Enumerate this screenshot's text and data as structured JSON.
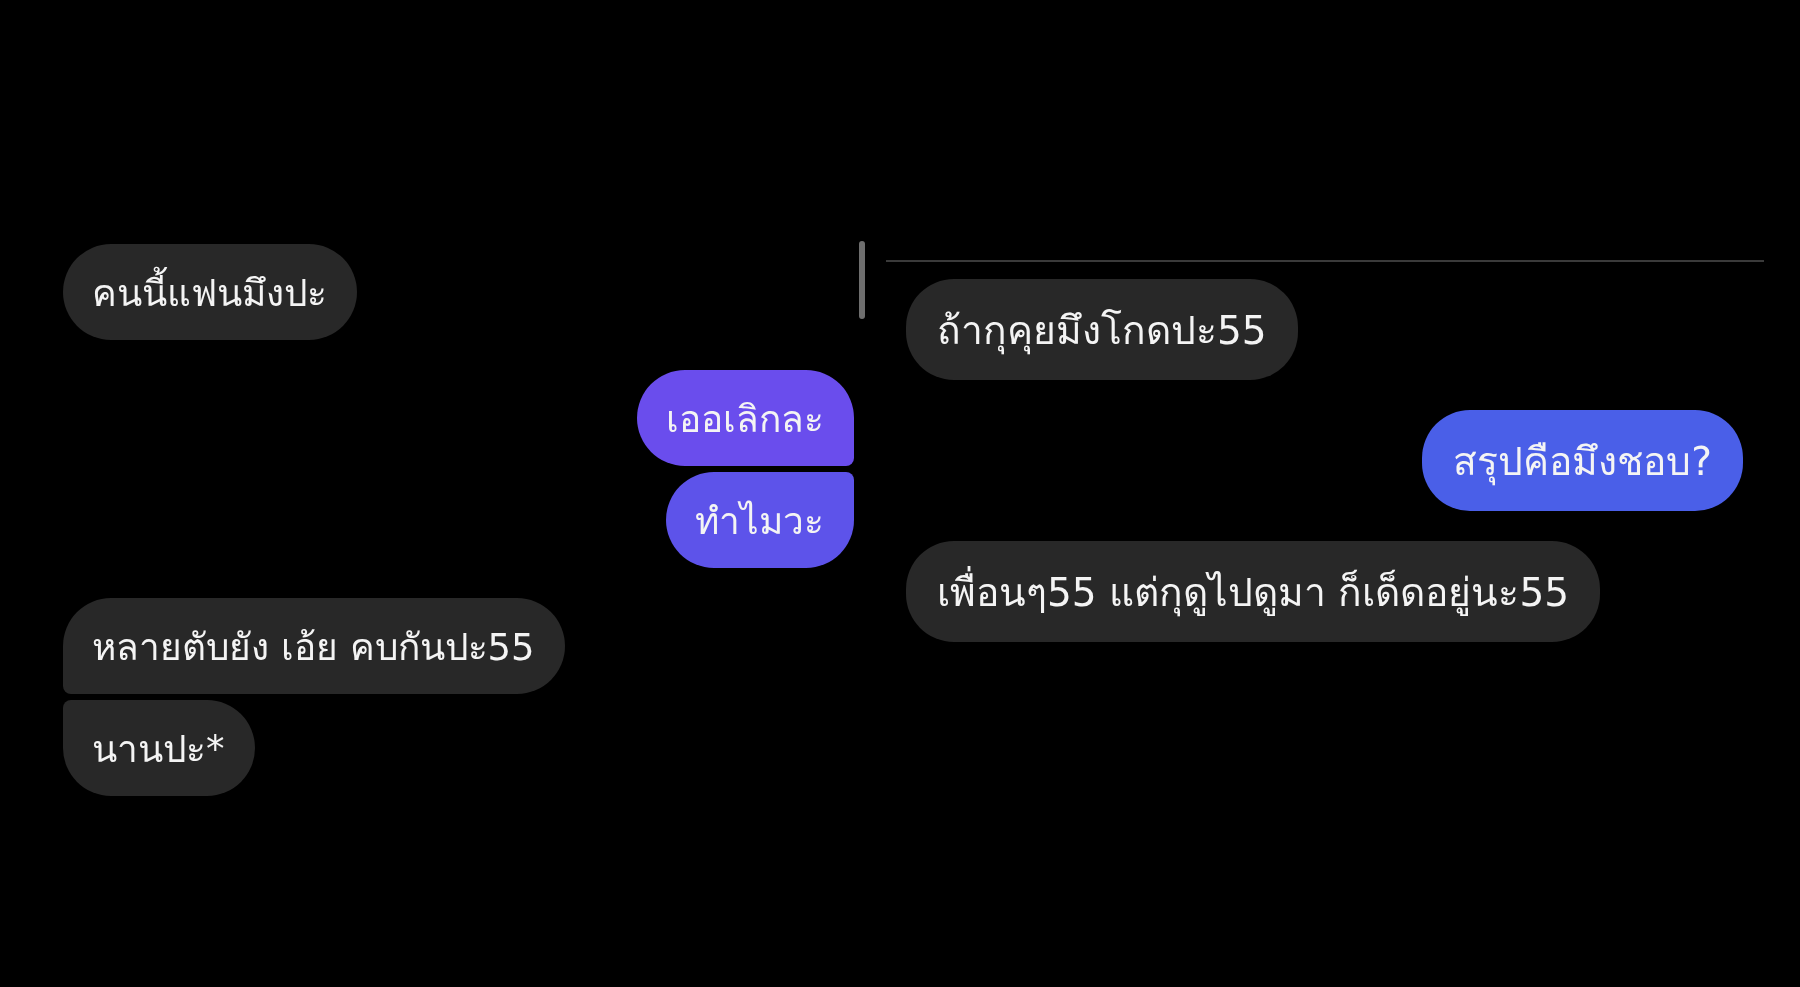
{
  "chats": [
    {
      "messages": [
        {
          "text": "คนนี้แฟนมึงปะ",
          "kind": "incoming",
          "color": "#282828"
        },
        {
          "text": "เออเลิกละ",
          "kind": "outgoing",
          "color": "#6a4ded"
        },
        {
          "text": "ทำไมวะ",
          "kind": "outgoing",
          "color": "#5d53ea"
        },
        {
          "text": "หลายตับยัง เอ้ย คบกันปะ55",
          "kind": "incoming",
          "color": "#282828"
        },
        {
          "text": "นานปะ*",
          "kind": "incoming",
          "color": "#282828"
        }
      ]
    },
    {
      "messages": [
        {
          "text": "ถ้ากุคุยมึงโกดปะ55",
          "kind": "incoming",
          "color": "#282828"
        },
        {
          "text": "สรุปคือมึงชอบ?",
          "kind": "outgoing",
          "color": "#4a5fe8"
        },
        {
          "text": "เพื่อนๆ55 แต่กุดูไปดูมา ก็เด็ดอยู่นะ55",
          "kind": "incoming",
          "color": "#282828"
        }
      ]
    }
  ]
}
